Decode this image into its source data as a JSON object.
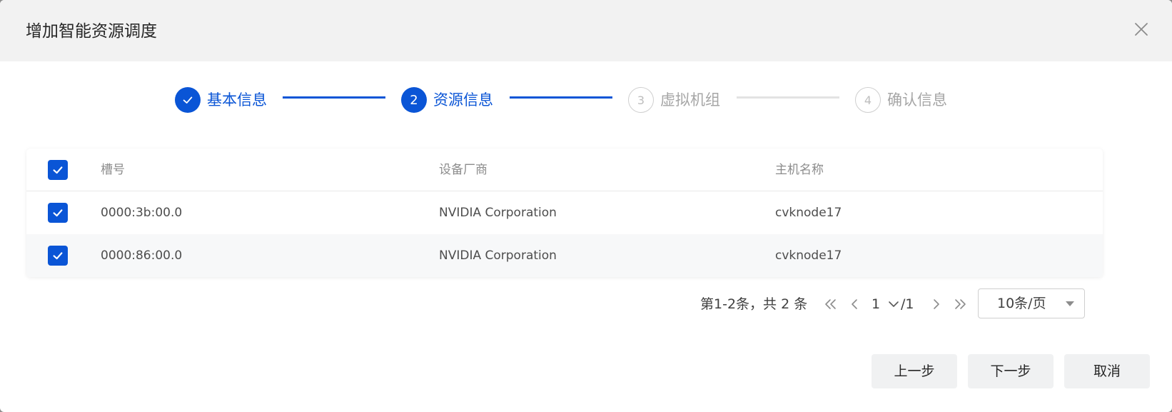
{
  "dialog": {
    "title": "增加智能资源调度",
    "close_icon": "close-icon"
  },
  "steps": [
    {
      "number": "",
      "label": "基本信息",
      "status": "done",
      "icon": "check-icon"
    },
    {
      "number": "2",
      "label": "资源信息",
      "status": "active"
    },
    {
      "number": "3",
      "label": "虚拟机组",
      "status": "pending"
    },
    {
      "number": "4",
      "label": "确认信息",
      "status": "pending"
    }
  ],
  "table": {
    "columns": {
      "slot": "槽号",
      "vendor": "设备厂商",
      "host": "主机名称"
    },
    "header_checked": true,
    "rows": [
      {
        "checked": true,
        "slot": "0000:3b:00.0",
        "vendor": "NVIDIA Corporation",
        "host": "cvknode17"
      },
      {
        "checked": true,
        "slot": "0000:86:00.0",
        "vendor": "NVIDIA Corporation",
        "host": "cvknode17"
      }
    ]
  },
  "pagination": {
    "total_text": "第1-2条，共 2 条",
    "current_page": "1",
    "total_pages": "/1",
    "page_size": "10条/页"
  },
  "footer": {
    "prev_label": "上一步",
    "next_label": "下一步",
    "cancel_label": "取消"
  },
  "colors": {
    "primary": "#0a55d6",
    "header_bg": "#f2f2f2",
    "button_bg": "#f0f1f2"
  }
}
